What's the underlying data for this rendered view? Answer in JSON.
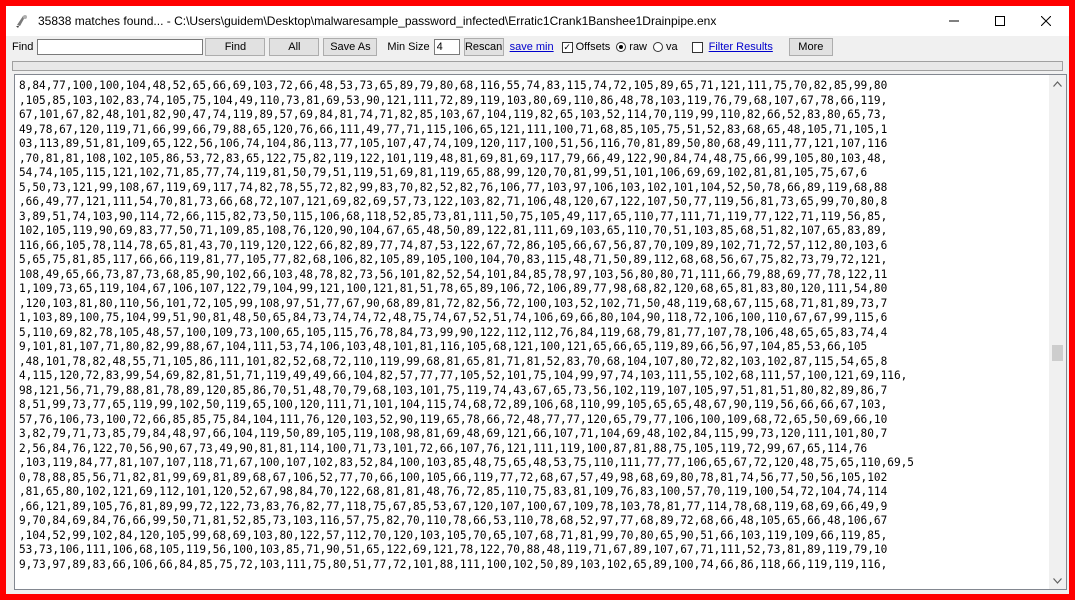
{
  "window": {
    "title": "35838 matches found...  -  C:\\Users\\guidem\\Desktop\\malwaresample_password_infected\\Erratic1Crank1Banshee1Drainpipe.enx"
  },
  "toolbar": {
    "find_label": "Find",
    "find_value": "",
    "find_button": "Find",
    "all_button": "All",
    "save_as_button": "Save As",
    "min_size_label": "Min Size",
    "min_size_value": "4",
    "rescan_button": "Rescan",
    "save_min_link": "save min",
    "offsets_label": "Offsets",
    "offsets_checked": true,
    "raw_label": "raw",
    "va_label": "va",
    "filter_results_link": "Filter Results",
    "more_button": "More"
  },
  "content": {
    "lines": [
      "8,84,77,100,100,104,48,52,65,66,69,103,72,66,48,53,73,65,89,79,80,68,116,55,74,83,115,74,72,105,89,65,71,121,111,75,70,82,85,99,80",
      ",105,85,103,102,83,74,105,75,104,49,110,73,81,69,53,90,121,111,72,89,119,103,80,69,110,86,48,78,103,119,76,79,68,107,67,78,66,119,",
      "67,101,67,82,48,101,82,90,47,74,119,89,57,69,84,81,74,71,82,85,103,67,104,119,82,65,103,52,114,70,119,99,110,82,66,52,83,80,65,73,",
      "49,78,67,120,119,71,66,99,66,79,88,65,120,76,66,111,49,77,71,115,106,65,121,111,100,71,68,85,105,75,51,52,83,68,65,48,105,71,105,1",
      "03,113,89,51,81,109,65,122,56,106,74,104,86,113,77,105,107,47,74,109,120,117,100,51,56,116,70,81,89,50,80,68,49,111,77,121,107,116",
      ",70,81,81,108,102,105,86,53,72,83,65,122,75,82,119,122,101,119,48,81,69,81,69,117,79,66,49,122,90,84,74,48,75,66,99,105,80,103,48,",
      "54,74,105,115,121,102,71,85,77,74,119,81,50,79,51,119,51,69,81,119,65,88,99,120,70,81,99,51,101,106,69,69,102,81,81,105,75,67,6",
      "5,50,73,121,99,108,67,119,69,117,74,82,78,55,72,82,99,83,70,82,52,82,76,106,77,103,97,106,103,102,101,104,52,50,78,66,89,119,68,88",
      ",66,49,77,121,111,54,70,81,73,66,68,72,107,121,69,82,69,57,73,122,103,82,71,106,48,120,67,122,107,50,77,119,56,81,73,65,99,70,80,8",
      "3,89,51,74,103,90,114,72,66,115,82,73,50,115,106,68,118,52,85,73,81,111,50,75,105,49,117,65,110,77,111,71,119,77,122,71,119,56,85,",
      "102,105,119,90,69,83,77,50,71,109,85,108,76,120,90,104,67,65,48,50,89,122,81,111,69,103,65,110,70,51,103,85,68,51,82,107,65,83,89,",
      "116,66,105,78,114,78,65,81,43,70,119,120,122,66,82,89,77,74,87,53,122,67,72,86,105,66,67,56,87,70,109,89,102,71,72,57,112,80,103,6",
      "5,65,75,81,85,117,66,66,119,81,77,105,77,82,68,106,82,105,89,105,100,104,70,83,115,48,71,50,89,112,68,68,56,67,75,82,73,79,72,121,",
      "108,49,65,66,73,87,73,68,85,90,102,66,103,48,78,82,73,56,101,82,52,54,101,84,85,78,97,103,56,80,80,71,111,66,79,88,69,77,78,122,11",
      "1,109,73,65,119,104,67,106,107,122,79,104,99,121,100,121,81,51,78,65,89,106,72,106,89,77,98,68,82,120,68,65,81,83,80,120,111,54,80",
      ",120,103,81,80,110,56,101,72,105,99,108,97,51,77,67,90,68,89,81,72,82,56,72,100,103,52,102,71,50,48,119,68,67,115,68,71,81,89,73,7",
      "1,103,89,100,75,104,99,51,90,81,48,50,65,84,73,74,74,72,48,75,74,67,52,51,74,106,69,66,80,104,90,118,72,106,100,110,67,67,99,115,6",
      "5,110,69,82,78,105,48,57,100,109,73,100,65,105,115,76,78,84,73,99,90,122,112,112,76,84,119,68,79,81,77,107,78,106,48,65,65,83,74,4",
      "9,101,81,107,71,80,82,99,88,67,104,111,53,74,106,103,48,101,81,116,105,68,121,100,121,65,66,65,119,89,66,56,97,104,85,53,66,105",
      ",48,101,78,82,48,55,71,105,86,111,101,82,52,68,72,110,119,99,68,81,65,81,71,81,52,83,70,68,104,107,80,72,82,103,102,87,115,54,65,8",
      "4,115,120,72,83,99,54,69,82,81,51,71,119,49,49,66,104,82,57,77,77,105,52,101,75,104,99,97,74,103,111,55,102,68,111,57,100,121,69,116,",
      "98,121,56,71,79,88,81,78,89,120,85,86,70,51,48,70,79,68,103,101,75,119,74,43,67,65,73,56,102,119,107,105,97,51,81,51,80,82,89,86,7",
      "8,51,99,73,77,65,119,99,102,50,119,65,100,120,111,71,101,104,115,74,68,72,89,106,68,110,99,105,65,65,48,67,90,119,56,66,66,67,103,",
      "57,76,106,73,100,72,66,85,85,75,84,104,111,76,120,103,52,90,119,65,78,66,72,48,77,77,120,65,79,77,106,100,109,68,72,65,50,69,66,10",
      "3,82,79,71,73,85,79,84,48,97,66,104,119,50,89,105,119,108,98,81,69,48,69,121,66,107,71,104,69,48,102,84,115,99,73,120,111,101,80,7",
      "2,56,84,76,122,70,56,90,67,73,49,90,81,81,114,100,71,73,101,72,66,107,76,121,111,119,100,87,81,88,75,105,119,72,99,67,65,114,76",
      ",103,119,84,77,81,107,107,118,71,67,100,107,102,83,52,84,100,103,85,48,75,65,48,53,75,110,111,77,77,106,65,67,72,120,48,75,65,110,69,5",
      "0,78,88,85,56,71,82,81,99,69,81,89,68,67,106,52,77,70,66,100,105,66,119,77,72,68,67,57,49,98,68,69,80,78,81,74,56,77,50,56,105,102",
      ",81,65,80,102,121,69,112,101,120,52,67,98,84,70,122,68,81,81,48,76,72,85,110,75,83,81,109,76,83,100,57,70,119,100,54,72,104,74,114",
      ",66,121,89,105,76,81,89,99,72,122,73,83,76,82,77,118,75,67,85,53,67,120,107,100,67,109,78,103,78,81,77,114,78,68,119,68,69,66,49,9",
      "9,70,84,69,84,76,66,99,50,71,81,52,85,73,103,116,57,75,82,70,110,78,66,53,110,78,68,52,97,77,68,89,72,68,66,48,105,65,66,48,106,67",
      ",104,52,99,102,84,120,105,99,68,69,103,80,122,57,112,70,120,103,105,70,65,107,68,71,81,99,70,80,65,90,51,66,103,119,109,66,119,85,",
      "53,73,106,111,106,68,105,119,56,100,103,85,71,90,51,65,122,69,121,78,122,70,88,48,119,71,67,89,107,67,71,111,52,73,81,89,119,79,10",
      "9,73,97,89,83,66,106,66,84,85,75,72,103,111,75,80,51,77,72,101,88,111,100,102,50,89,103,102,65,89,100,74,66,86,118,66,119,119,116,"
    ]
  }
}
